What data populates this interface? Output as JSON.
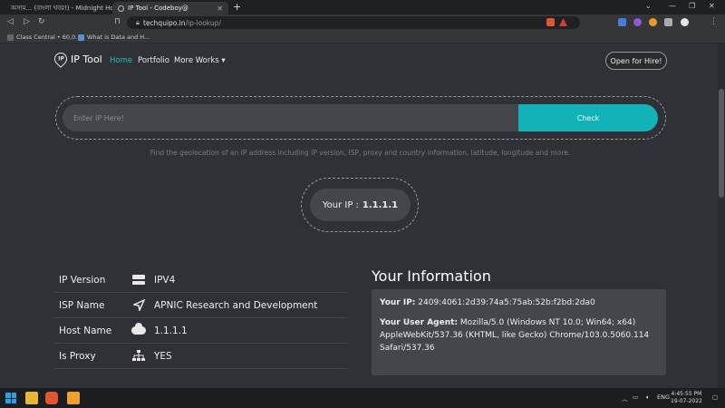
{
  "browser": {
    "tabs": [
      {
        "label": "অসাম... (বাংলা খবর!) - Midnight Horro",
        "active": false
      },
      {
        "label": "IP Tool - Codeboy@",
        "active": true
      }
    ],
    "new_tab": "+",
    "url_domain": "techquipo.in",
    "url_path": "/ip-lookup/",
    "bookmarks": [
      "Class Central • 60,0...",
      "What is Data and H..."
    ],
    "window_controls": {
      "minimize": "—",
      "maximize": "❐",
      "close": "✕",
      "dropdown": "⌄"
    }
  },
  "header": {
    "logo_text": "IP Tool",
    "nav": [
      "Home",
      "Portfolio",
      "More Works ▾"
    ],
    "hire_button": "Open for Hire!"
  },
  "search": {
    "placeholder": "Enter IP Here!",
    "button": "Check",
    "description": "Find the geolocation of an IP address including IP version, ISP, proxy and country information, latitude, longitude and more."
  },
  "my_ip": {
    "label": "Your IP :",
    "value": "1.1.1.1"
  },
  "info": [
    {
      "label": "IP Version",
      "icon": "server-icon",
      "value": "IPV4"
    },
    {
      "label": "ISP Name",
      "icon": "location-arrow-icon",
      "value": "APNIC Research and Development"
    },
    {
      "label": "Host Name",
      "icon": "cloud-icon",
      "value": "1.1.1.1"
    },
    {
      "label": "Is Proxy",
      "icon": "network-icon",
      "value": "YES"
    }
  ],
  "your_info": {
    "title": "Your Information",
    "ip_label": "Your IP:",
    "ip_value": "2409:4061:2d39:74a5:75ab:52b:f2bd:2da0",
    "ua_label": "Your User Agent:",
    "ua_value": "Mozilla/5.0 (Windows NT 10.0; Win64; x64) AppleWebKit/537.36 (KHTML, like Gecko) Chrome/103.0.5060.114 Safari/537.36"
  },
  "taskbar": {
    "lang": "ENG",
    "time": "4:45:55 PM",
    "date": "19-07-2022"
  }
}
